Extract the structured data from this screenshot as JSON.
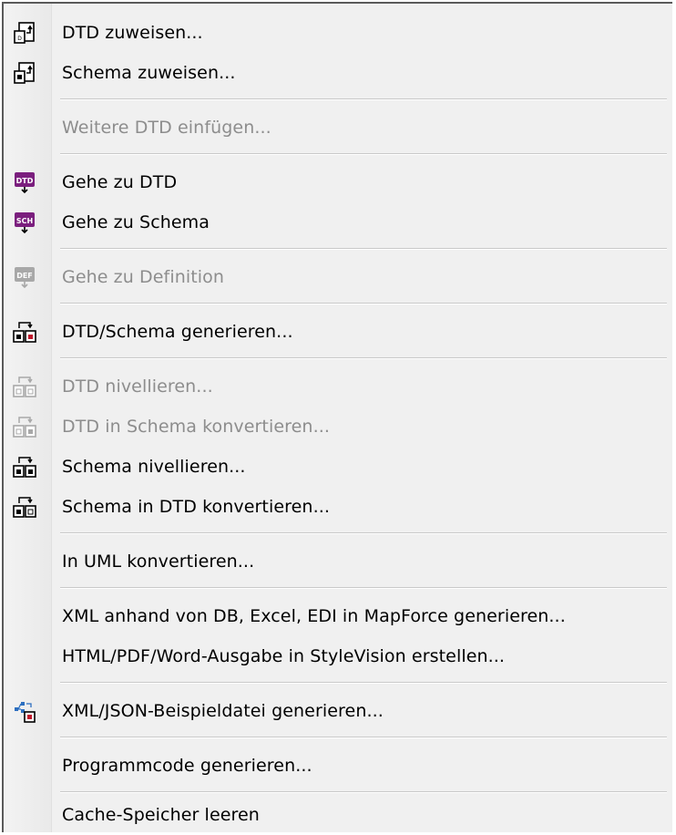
{
  "menu": {
    "items": [
      {
        "label": "DTD zuweisen...",
        "icon": "assign-dtd-icon"
      },
      {
        "label": "Schema zuweisen...",
        "icon": "assign-schema-icon"
      },
      {
        "label": "Weitere DTD einfügen...",
        "icon": "",
        "disabled": true
      },
      {
        "label": "Gehe zu DTD",
        "icon": "dtd-icon"
      },
      {
        "label": "Gehe zu Schema",
        "icon": "sch-icon"
      },
      {
        "label": "Gehe zu Definition",
        "icon": "def-icon",
        "disabled": true
      },
      {
        "label": "DTD/Schema generieren...",
        "icon": "generate-schema-icon"
      },
      {
        "label": "DTD nivellieren...",
        "icon": "flatten-dtd-icon",
        "disabled": true
      },
      {
        "label": "DTD in Schema konvertieren...",
        "icon": "convert-dtd-icon",
        "disabled": true
      },
      {
        "label": "Schema nivellieren...",
        "icon": "flatten-schema-icon"
      },
      {
        "label": "Schema in DTD konvertieren...",
        "icon": "convert-schema-icon"
      },
      {
        "label": "In UML konvertieren...",
        "icon": ""
      },
      {
        "label": "XML anhand von DB, Excel, EDI in MapForce  generieren...",
        "icon": ""
      },
      {
        "label": "HTML/PDF/Word-Ausgabe in StyleVision erstellen...",
        "icon": ""
      },
      {
        "label": "XML/JSON-Beispieldatei generieren...",
        "icon": "sample-file-icon"
      },
      {
        "label": "Programmcode generieren...",
        "icon": ""
      },
      {
        "label": "Cache-Speicher leeren",
        "icon": ""
      }
    ]
  },
  "icon_text": {
    "dtd": "DTD",
    "sch": "SCH",
    "def": "DEF"
  },
  "colors": {
    "menu_background": "#f0f0f0",
    "disabled_text": "#8d8d8d",
    "icon_purple": "#7b1f7e",
    "icon_red": "#c0162b"
  }
}
